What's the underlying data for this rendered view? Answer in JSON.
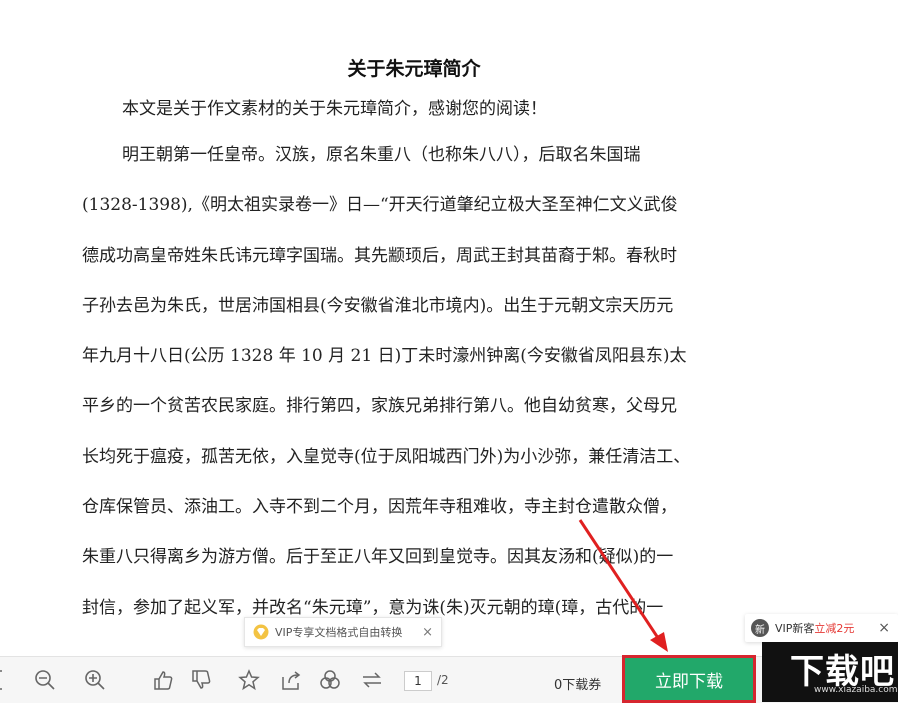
{
  "document": {
    "title": "关于朱元璋简介",
    "intro": "本文是关于作文素材的关于朱元璋简介，感谢您的阅读！",
    "lines": [
      "明王朝第一任皇帝。汉族，原名朱重八（也称朱八八），后取名朱国瑞",
      "(1328-1398),《明太祖实录卷一》日—“开天行道肇纪立极大圣至神仁文义武俊",
      "德成功高皇帝姓朱氏讳元璋字国瑞。其先颛顼后，周武王封其苗裔于邾。春秋时",
      "子孙去邑为朱氏，世居沛国相县(今安徽省淮北市境内)。出生于元朝文宗天历元",
      "年九月十八日(公历 1328 年 10 月 21 日)丁未时濠州钟离(今安徽省凤阳县东)太",
      "平乡的一个贫苦农民家庭。排行第四，家族兄弟排行第八。他自幼贫寒，父母兄",
      "长均死于瘟疫，孤苦无依，入皇觉寺(位于凤阳城西门外)为小沙弥，兼任清洁工、",
      "仓库保管员、添油工。入寺不到二个月，因荒年寺租难收，寺主封仓遣散众僧，",
      "朱重八只得离乡为游方僧。后于至正八年又回到皇觉寺。因其友汤和(疑似)的一",
      "封信，参加了起义军，并改名“朱元璋”，意为诛(朱)灭元朝的璋(璋，古代的一"
    ]
  },
  "vip_banner": {
    "text": "VIP专享文档格式自由转换",
    "close": "×"
  },
  "newbie": {
    "badge": "新",
    "text": "VIP新客",
    "highlight": "立减2元",
    "close": "×"
  },
  "toolbar": {
    "current_page": "1",
    "total_pages": "/2",
    "vouchers": "0下载券",
    "download_label": "立即下载"
  },
  "logo": {
    "text": "下载吧",
    "url_text": "www.xiazaiba.com"
  },
  "colors": {
    "download_green": "#22a86a",
    "highlight_red": "#d6262f"
  }
}
